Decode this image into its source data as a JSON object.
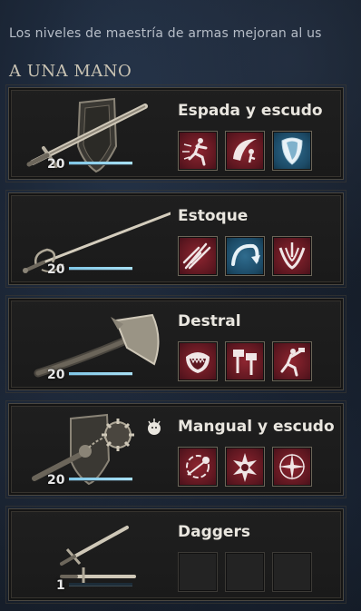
{
  "intro_text": "Los niveles de maestría de armas mejoran al us",
  "section_title": "A UNA MANO",
  "weapons": [
    {
      "name": "Espada y escudo",
      "level": "20",
      "progress": 1.0,
      "skills": [
        "red",
        "red",
        "blue"
      ],
      "skill_icons": [
        "sword-dash-icon",
        "slash-arc-icon",
        "shield-block-icon"
      ]
    },
    {
      "name": "Estoque",
      "level": "20",
      "progress": 1.0,
      "skills": [
        "red",
        "blue",
        "red"
      ],
      "skill_icons": [
        "flurry-strikes-icon",
        "evade-arc-icon",
        "riposte-icon"
      ]
    },
    {
      "name": "Destral",
      "level": "20",
      "progress": 1.0,
      "skills": [
        "red",
        "red",
        "red"
      ],
      "skill_icons": [
        "berserk-mouth-icon",
        "twin-hatchets-icon",
        "leap-strike-icon"
      ]
    },
    {
      "name": "Mangual y escudo",
      "level": "20",
      "progress": 1.0,
      "skills": [
        "red",
        "red",
        "red"
      ],
      "skill_icons": [
        "spin-flail-icon",
        "shattering-strike-icon",
        "holy-burst-icon"
      ]
    },
    {
      "name": "Daggers",
      "level": "1",
      "progress": 0.0,
      "skills": [
        "empty",
        "empty",
        "empty"
      ],
      "skill_icons": [
        "empty-slot",
        "empty-slot",
        "empty-slot"
      ]
    }
  ],
  "colors": {
    "accent_red": "#8e2530",
    "accent_blue": "#2f6c8e",
    "bar_fill": "#8fd0ec"
  }
}
